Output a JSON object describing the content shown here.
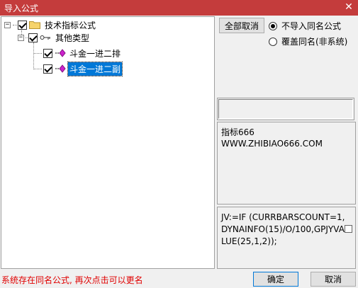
{
  "window": {
    "title": "导入公式",
    "close_glyph": "✕"
  },
  "tree": {
    "root": {
      "label": "技术指标公式",
      "checked": true,
      "expander": "−"
    },
    "group": {
      "label": "其他类型",
      "checked": true,
      "expander": "−"
    },
    "items": [
      {
        "label": "斗金一进二排",
        "checked": true,
        "selected": false
      },
      {
        "label": "斗金一进二副",
        "checked": true,
        "selected": true
      }
    ]
  },
  "options": {
    "deselect_all_label": "全部取消",
    "radio_skip_label": "不导入同名公式",
    "radio_overwrite_label": "覆盖同名(非系统)",
    "selected": "skip"
  },
  "description": {
    "line1": "指标666",
    "line2": "WWW.ZHIBIAO666.COM"
  },
  "code": {
    "text": "JV:=IF (CURRBARSCOUNT=1,DYNAINFO(15)/O/100,GPJYVALUE(25,1,2));"
  },
  "footer": {
    "status": "系统存在同名公式, 再次点击可以更名",
    "ok_label": "确定",
    "cancel_label": "取消"
  }
}
